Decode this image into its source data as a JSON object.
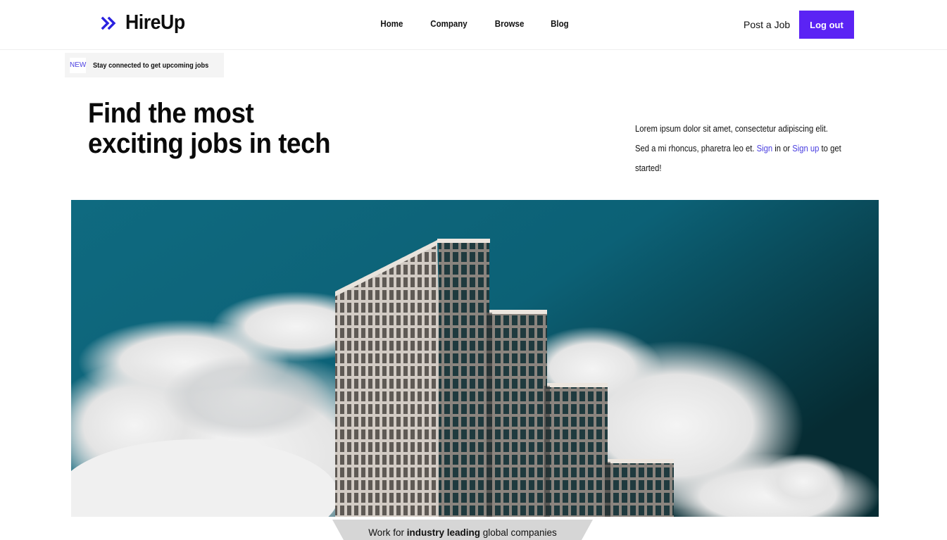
{
  "header": {
    "logo_text": "HireUp",
    "logo_icon": "double-chevron-right-icon",
    "nav": [
      "Home",
      "Company",
      "Browse",
      "Blog"
    ],
    "post_job_label": "Post a Job",
    "logout_label": "Log out"
  },
  "announcement": {
    "badge": "NEW",
    "text": "Stay connected to get upcoming jobs"
  },
  "hero": {
    "title_line1": "Find the most",
    "title_line2": "exciting jobs in tech",
    "desc_before": "Lorem ipsum dolor sit amet, consectetur adipiscing elit. Sed a mi rhoncus, pharetra leo et. ",
    "sign_in_link": "Sign",
    "desc_middle": " in or ",
    "sign_up_link": "Sign up",
    "desc_after": " to get started!"
  },
  "ribbon": {
    "prefix": "Work for ",
    "bold": "industry leading",
    "suffix": " global companies"
  },
  "colors": {
    "accent": "#5b23f4",
    "link": "#4a3fe0",
    "sky": "#0f6a80"
  }
}
